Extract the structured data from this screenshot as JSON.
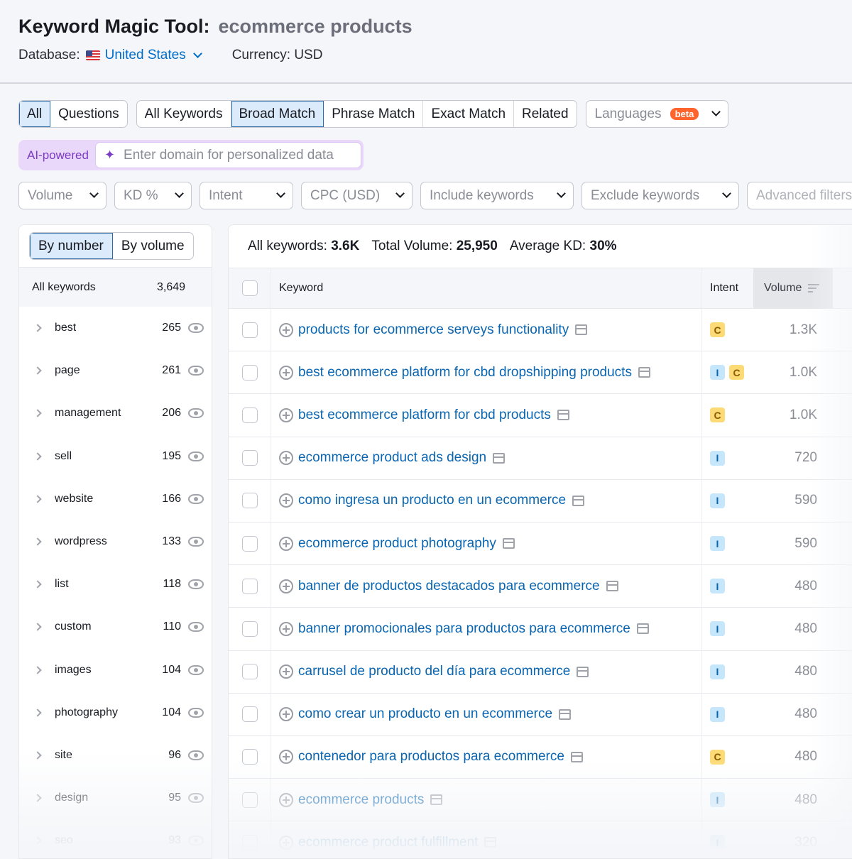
{
  "header": {
    "title": "Keyword Magic Tool:",
    "query": "ecommerce products",
    "database_label": "Database:",
    "database_value": "United States",
    "currency": "Currency: USD"
  },
  "tabs": {
    "question_group": [
      "All",
      "Questions"
    ],
    "match_group": [
      "All Keywords",
      "Broad Match",
      "Phrase Match",
      "Exact Match",
      "Related"
    ],
    "active_question": "All",
    "active_match": "Broad Match",
    "languages_label": "Languages",
    "languages_badge": "beta"
  },
  "ai": {
    "label": "AI-powered",
    "placeholder": "Enter domain for personalized data"
  },
  "filters": [
    "Volume",
    "KD %",
    "Intent",
    "CPC (USD)",
    "Include keywords",
    "Exclude keywords",
    "Advanced filters"
  ],
  "sidebar": {
    "toggle": [
      "By number",
      "By volume"
    ],
    "active_toggle": "By number",
    "all_label": "All keywords",
    "all_count": "3,649",
    "groups": [
      {
        "name": "best",
        "count": "265"
      },
      {
        "name": "page",
        "count": "261"
      },
      {
        "name": "management",
        "count": "206"
      },
      {
        "name": "sell",
        "count": "195"
      },
      {
        "name": "website",
        "count": "166"
      },
      {
        "name": "wordpress",
        "count": "133"
      },
      {
        "name": "list",
        "count": "118"
      },
      {
        "name": "custom",
        "count": "110"
      },
      {
        "name": "images",
        "count": "104"
      },
      {
        "name": "photography",
        "count": "104"
      },
      {
        "name": "site",
        "count": "96"
      },
      {
        "name": "design",
        "count": "95"
      },
      {
        "name": "seo",
        "count": "93"
      }
    ]
  },
  "summary": {
    "all_keywords_label": "All keywords:",
    "all_keywords_value": "3.6K",
    "total_volume_label": "Total Volume:",
    "total_volume_value": "25,950",
    "avg_kd_label": "Average KD:",
    "avg_kd_value": "30%"
  },
  "table": {
    "columns": {
      "keyword": "Keyword",
      "intent": "Intent",
      "volume": "Volume"
    },
    "rows": [
      {
        "keyword": "products for ecommerce serveys functionality",
        "intent": [
          "C"
        ],
        "volume": "1.3K"
      },
      {
        "keyword": "best ecommerce platform for cbd dropshipping products",
        "intent": [
          "I",
          "C"
        ],
        "volume": "1.0K"
      },
      {
        "keyword": "best ecommerce platform for cbd products",
        "intent": [
          "C"
        ],
        "volume": "1.0K"
      },
      {
        "keyword": "ecommerce product ads design",
        "intent": [
          "I"
        ],
        "volume": "720"
      },
      {
        "keyword": "como ingresa un producto en un ecommerce",
        "intent": [
          "I"
        ],
        "volume": "590"
      },
      {
        "keyword": "ecommerce product photography",
        "intent": [
          "I"
        ],
        "volume": "590"
      },
      {
        "keyword": "banner de productos destacados para ecommerce",
        "intent": [
          "I"
        ],
        "volume": "480"
      },
      {
        "keyword": "banner promocionales para productos para ecommerce",
        "intent": [
          "I"
        ],
        "volume": "480"
      },
      {
        "keyword": "carrusel de producto del día para ecommerce",
        "intent": [
          "I"
        ],
        "volume": "480"
      },
      {
        "keyword": "como crear un producto en un ecommerce",
        "intent": [
          "I"
        ],
        "volume": "480"
      },
      {
        "keyword": "contenedor para productos para ecommerce",
        "intent": [
          "C"
        ],
        "volume": "480"
      },
      {
        "keyword": "ecommerce products",
        "intent": [
          "I"
        ],
        "volume": "480"
      },
      {
        "keyword": "ecommerce product fulfillment",
        "intent": [
          "I"
        ],
        "volume": "320"
      }
    ]
  },
  "colors": {
    "link_blue": "#0a65b0",
    "active_tab_bg": "#dcebfb",
    "beta_orange": "#ff642d",
    "ai_purple": "#7b3bc4",
    "intent_commercial": "#fcdb76",
    "intent_informational": "#c6e6fc"
  }
}
